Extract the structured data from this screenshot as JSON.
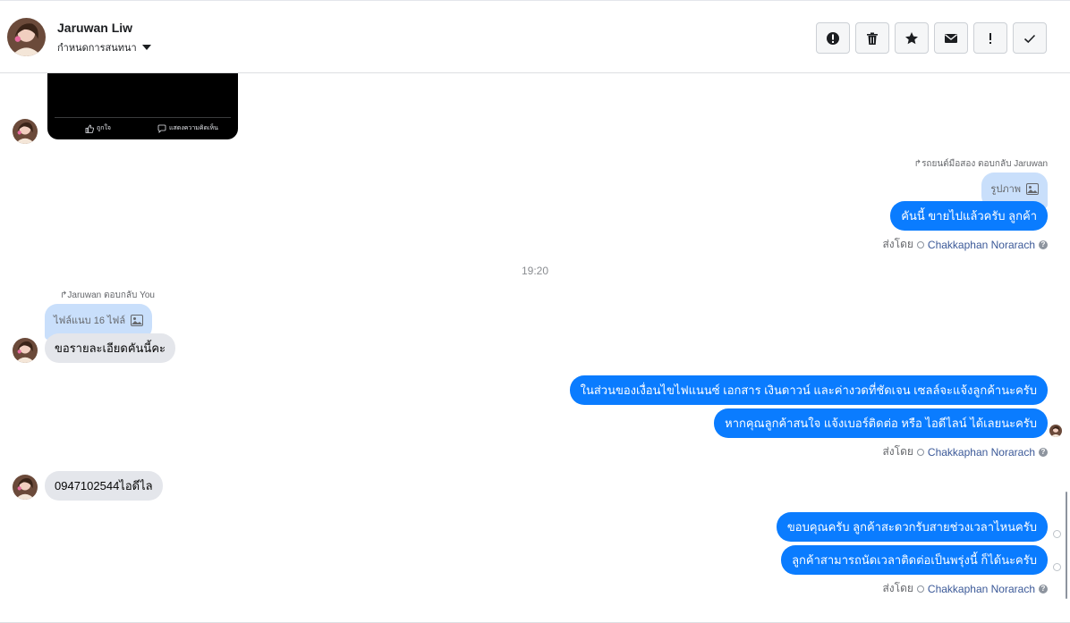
{
  "header": {
    "contact_name": "Jaruwan Liw",
    "assign_label": "กำหนดการสนทนา",
    "tools": [
      {
        "icon": "alert-circle-icon",
        "name": "mark-spam-button"
      },
      {
        "icon": "trash-icon",
        "name": "delete-button"
      },
      {
        "icon": "star-icon",
        "name": "star-button"
      },
      {
        "icon": "envelope-icon",
        "name": "mark-unread-button"
      },
      {
        "icon": "exclamation-icon",
        "name": "follow-up-button"
      },
      {
        "icon": "check-icon",
        "name": "mark-done-button"
      }
    ]
  },
  "video_card": {
    "like_label": "ถูกใจ",
    "comment_label": "แสดงความคิดเห็น"
  },
  "messages": {
    "reply1_label": "รถยนต์มือสอง ตอบกลับ Jaruwan",
    "reply1_quote": "รูปภาพ",
    "out1": "คันนี้ ขายไปแล้วครับ ลูกค้า",
    "sent_by_label": "ส่งโดย",
    "agent_name": "Chakkaphan Norarach",
    "time_divider": "19:20",
    "reply2_label": "Jaruwan ตอบกลับ You",
    "reply2_quote": "ไฟล์แนบ 16 ไฟล์",
    "in1": "ขอรายละเอียดคันนี้คะ",
    "out2": "ในส่วนของเงื่อนไขไฟแนนซ์ เอกสาร เงินดาวน์ และค่างวดที่ชัดเจน เซลล์จะแจ้งลูกค้านะครับ",
    "out3": "หากคุณลูกค้าสนใจ แจ้งเบอร์ติดต่อ หรือ ไอดีไลน์ ได้เลยนะครับ",
    "in2": "0947102544ไอดีไล",
    "out4": "ขอบคุณครับ ลูกค้าสะดวกรับสายช่วงเวลาไหนครับ",
    "out5": "ลูกค้าสามารถนัดเวลาติดต่อเป็นพรุ่งนี้ ก็ได้นะครับ"
  },
  "colors": {
    "outgoing_bubble": "#0a7cff",
    "incoming_bubble": "#e4e6eb",
    "quote_bubble": "#c9dffb",
    "agent_link": "#3b5998"
  }
}
